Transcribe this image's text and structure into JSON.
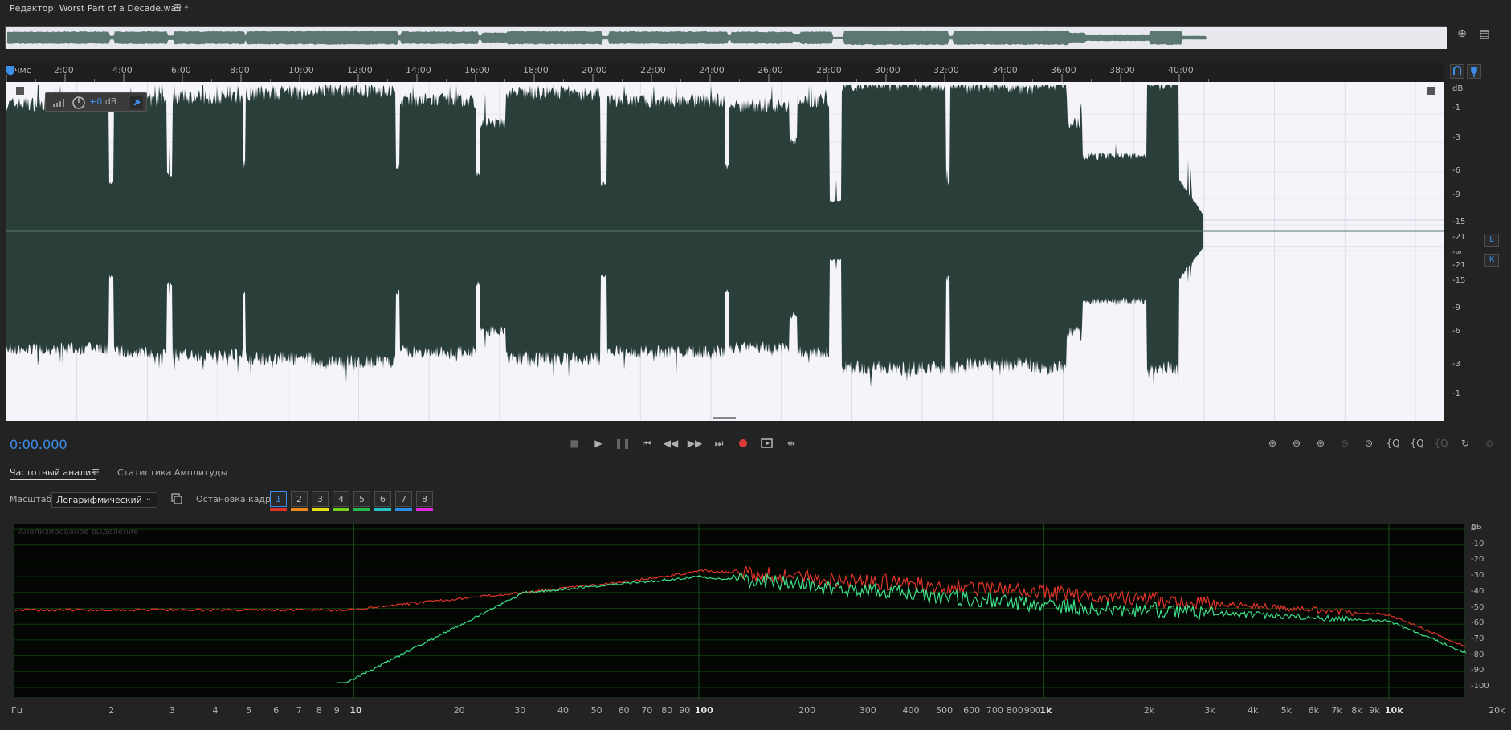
{
  "window": {
    "title": "Редактор: Worst Part of a Decade.wav *",
    "menu_icon": "hamburger-icon"
  },
  "ruler": {
    "start_label": "чмс",
    "labels": [
      "2:00",
      "4:00",
      "6:00",
      "8:00",
      "10:00",
      "12:00",
      "14:00",
      "16:00",
      "18:00",
      "20:00",
      "22:00",
      "24:00",
      "26:00",
      "28:00",
      "30:00",
      "32:00",
      "34:00",
      "36:00",
      "38:00",
      "40:00"
    ]
  },
  "hud": {
    "gain_value": "+0",
    "gain_unit": "dB"
  },
  "db_scale": {
    "unit": "dB",
    "labels": [
      "-1",
      "-3",
      "-6",
      "-9",
      "-15",
      "-21",
      "-∞",
      "-21",
      "-15",
      "-9",
      "-6",
      "-3",
      "-1"
    ]
  },
  "channels": {
    "left": "L",
    "right": "K"
  },
  "transport": {
    "time": "0:00.000",
    "buttons": [
      "stop-icon",
      "play-icon",
      "pause-icon",
      "skip-start-icon",
      "rewind-icon",
      "fast-forward-icon",
      "skip-end-icon",
      "record-icon",
      "loop-icon",
      "skip-selection-icon"
    ]
  },
  "panel": {
    "tabs": [
      {
        "label": "Частотный анализ",
        "active": true
      },
      {
        "label": "Статистика Амплитуды",
        "active": false
      }
    ],
    "scale_label": "Масштаб:",
    "scale_value": "Логарифмический",
    "freeze_label": "Остановка кадра:",
    "frames": [
      {
        "label": "1",
        "color": "#e0342a"
      },
      {
        "label": "2",
        "color": "#ef8a1a"
      },
      {
        "label": "3",
        "color": "#e6e21a"
      },
      {
        "label": "4",
        "color": "#76d41e"
      },
      {
        "label": "5",
        "color": "#25b84a"
      },
      {
        "label": "6",
        "color": "#24c4c8"
      },
      {
        "label": "7",
        "color": "#2b8de8"
      },
      {
        "label": "8",
        "color": "#e12adf"
      }
    ],
    "analyzed_caption": "Анализированое выделение"
  },
  "spectrum": {
    "y_unit": "дБ",
    "y_labels": [
      "0",
      "-10",
      "-20",
      "-30",
      "-40",
      "-50",
      "-60",
      "-70",
      "-80",
      "-90",
      "-100"
    ],
    "x_unit": "Гц",
    "x_labels": [
      "2",
      "3",
      "4",
      "5",
      "6",
      "7",
      "8",
      "9",
      "10",
      "20",
      "30",
      "40",
      "50",
      "60",
      "70",
      "80",
      "90",
      "100",
      "200",
      "300",
      "400",
      "500",
      "600",
      "700",
      "800",
      "900",
      "1k",
      "2k",
      "3k",
      "4k",
      "5k",
      "6k",
      "7k",
      "8k",
      "9k",
      "10k",
      "20k"
    ],
    "colors": {
      "left_channel": "#e0342a",
      "right_channel": "#3ee08a"
    }
  },
  "colors": {
    "accent": "#3d8eea",
    "waveform": "#2a3f3a",
    "waveform_bg": "#f4f4fa"
  }
}
